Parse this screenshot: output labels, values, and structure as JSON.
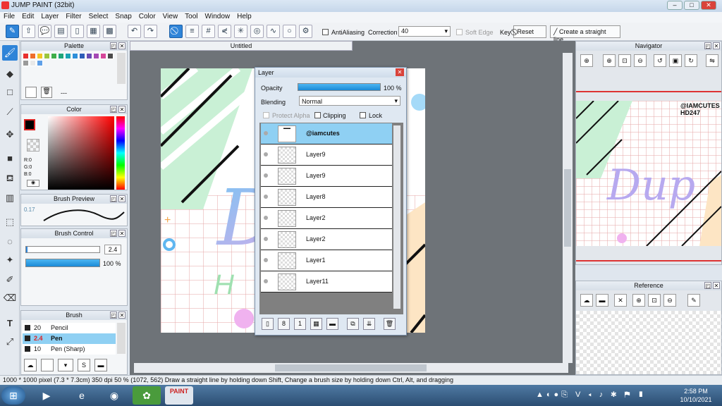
{
  "window": {
    "title": "JUMP PAINT (32bit)",
    "minimize": "–",
    "maximize": "□",
    "close": "✕"
  },
  "menu": [
    "File",
    "Edit",
    "Layer",
    "Filter",
    "Select",
    "Snap",
    "Color",
    "View",
    "Tool",
    "Window",
    "Help"
  ],
  "toolbar": {
    "antialiasing_label": "AntiAliasing",
    "correction_label": "Correction",
    "correction_value": "40",
    "soft_edge_label": "Soft Edge",
    "key_label": "Key",
    "reset_label": "Reset",
    "straight_line_label": "Create a straight line"
  },
  "palette": {
    "title": "Palette",
    "dash": "---",
    "swatches": [
      "#e8302f",
      "#ee6e2a",
      "#f3c623",
      "#9bc53d",
      "#3fae49",
      "#1fa67a",
      "#1aa3b3",
      "#2e8fd9",
      "#2e5db8",
      "#6a4cb3",
      "#a549b4",
      "#d6479a",
      "#4b4b4b",
      "#9a9a9a",
      "#e9e9e9",
      "#5fa0e8"
    ]
  },
  "color": {
    "title": "Color",
    "r": "R:0",
    "g": "G:0",
    "b": "B:0"
  },
  "brush_preview": {
    "title": "Brush Preview",
    "size": "0.17"
  },
  "brush_control": {
    "title": "Brush Control",
    "size_value": "2.4",
    "opacity_value": "100 %",
    "opacity": 1.0
  },
  "brush": {
    "title": "Brush",
    "items": [
      {
        "size": "20",
        "name": "Pencil"
      },
      {
        "size": "2.4",
        "name": "Pen"
      },
      {
        "size": "10",
        "name": "Pen (Sharp)"
      }
    ]
  },
  "canvas": {
    "tab_title": "Untitled",
    "watermark_text": "@IAMCUTES HD247",
    "art_text": "Dup"
  },
  "layer": {
    "title": "Layer",
    "opacity_label": "Opacity",
    "opacity_value": "100 %",
    "opacity": 1.0,
    "blending_label": "Blending",
    "blending_value": "Normal",
    "protect_alpha": "Protect Alpha",
    "clipping": "Clipping",
    "lock": "Lock",
    "layers": [
      "@iamcutes",
      "Layer9",
      "Layer9",
      "Layer8",
      "Layer2",
      "Layer2",
      "Layer1",
      "Layer11"
    ]
  },
  "navigator": {
    "title": "Navigator",
    "watermark_text": "@IAMCUTES HD247"
  },
  "reference": {
    "title": "Reference"
  },
  "status": {
    "size": "1000 * 1000 pixel",
    "cm": "(7.3 * 7.3cm)",
    "dpi": "350 dpi",
    "zoom": "50 %",
    "coords": "(1072, 562)",
    "hint": "Draw a straight line by holding down Shift, Change a brush size by holding down Ctrl, Alt, and dragging"
  },
  "taskbar": {
    "time": "2:58 PM",
    "date": "10/10/2021",
    "paint_label": "PAINT"
  }
}
